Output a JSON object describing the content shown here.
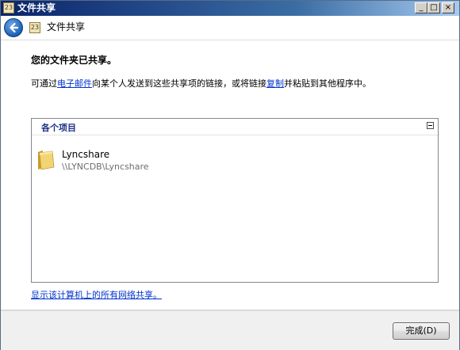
{
  "window": {
    "title": "文件共享",
    "title_icon_text": "23",
    "min_glyph": "_",
    "max_glyph": "□",
    "close_glyph": "×"
  },
  "nav": {
    "title": "文件共享",
    "icon_text": "23"
  },
  "main": {
    "heading": "您的文件夹已共享。",
    "desc_prefix": "可通过",
    "desc_email_link": "电子邮件",
    "desc_middle": "向某个人发送到这些共享项的链接，或将链接",
    "desc_copy_link": "复制",
    "desc_suffix": "并粘贴到其他程序中。"
  },
  "panel": {
    "header": "各个项目",
    "items": [
      {
        "name": "Lyncshare",
        "path": "\\\\LYNCDB\\Lyncshare"
      }
    ]
  },
  "show_all_link": "显示该计算机上的所有网络共享。",
  "footer": {
    "finish_label": "完成(D)"
  },
  "colors": {
    "link": "#0033cc",
    "panel_header": "#1e3287",
    "title_bar": "#0a246a"
  }
}
